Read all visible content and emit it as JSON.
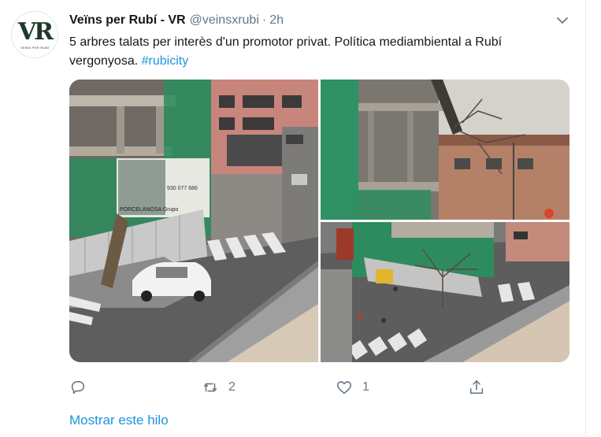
{
  "tweet": {
    "author_name": "Veïns per Rubí - VR",
    "author_handle": "@veinsxrubi",
    "separator": "·",
    "time": "2h",
    "avatar_letters": "VR",
    "avatar_sub": "VEÏNS PER RUBÍ",
    "text_main": "5 arbres talats per interès d'un promotor privat. Política mediambiental a Rubí vergonyosa. ",
    "hashtag": "#rubicity"
  },
  "photos": {
    "photo1_sign_top": "930 077 686",
    "photo1_sign_brand": "PORCELANOSA Grupo"
  },
  "actions": {
    "reply_icon": "reply-icon",
    "retweet_icon": "retweet-icon",
    "retweet_count": "2",
    "like_icon": "heart-icon",
    "like_count": "1",
    "share_icon": "share-icon"
  },
  "thread_link": "Mostrar este hilo",
  "colors": {
    "link": "#1b95e0",
    "text": "#14171a",
    "muted": "#657786"
  }
}
